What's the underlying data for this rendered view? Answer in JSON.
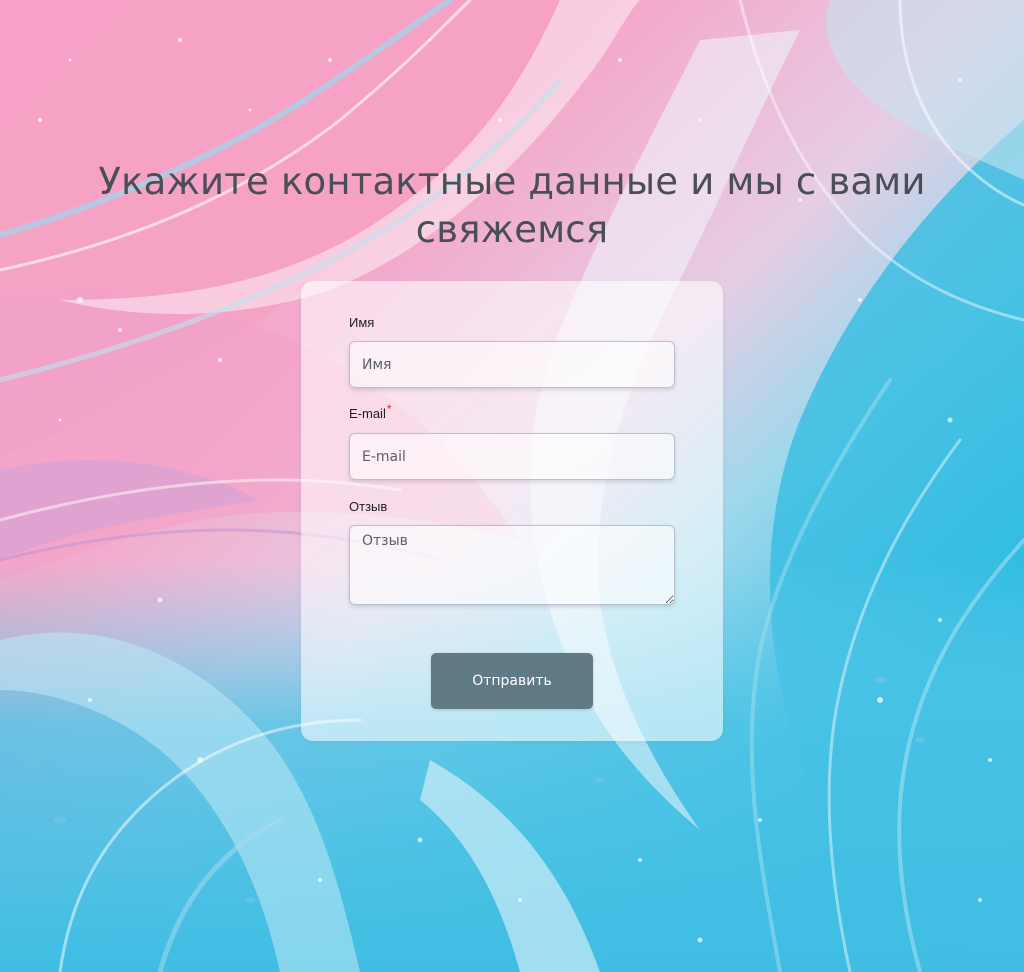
{
  "heading": {
    "line1": "Укажите контактные данные и мы с вами",
    "line2": "свяжемся"
  },
  "form": {
    "name": {
      "label": "Имя",
      "placeholder": "Имя",
      "value": ""
    },
    "email": {
      "label": "E-mail",
      "required_mark": "*",
      "placeholder": "E-mail",
      "value": ""
    },
    "review": {
      "label": "Отзыв",
      "placeholder": "Отзыв",
      "value": ""
    },
    "submit_label": "Отправить"
  },
  "colors": {
    "background_pink": "#f2a7c6",
    "background_blue": "#3dbfe0",
    "heading_text": "#4a4e55",
    "button": "#607a86",
    "required": "#e02a2a"
  },
  "background": {
    "image": "marbled-fluid-art-pink-blue"
  }
}
